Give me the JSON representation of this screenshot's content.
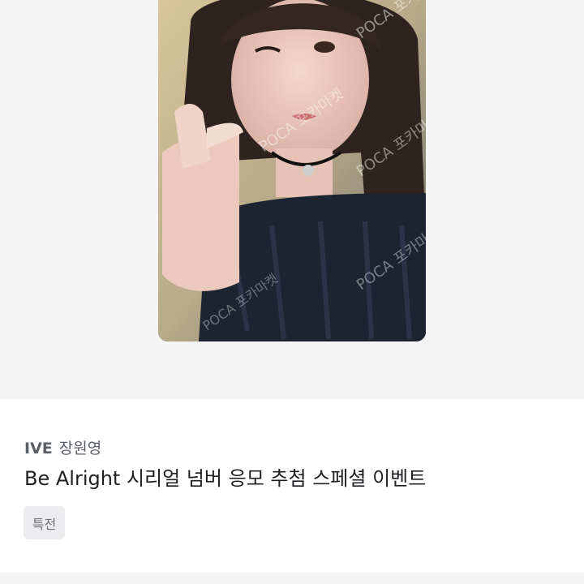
{
  "item": {
    "group": "IVE",
    "member": "장원영",
    "title": "Be Alright 시리얼 넘버 응모 추첨 스페셜 이벤트",
    "tag": "특전"
  },
  "photo": {
    "watermark": "POCA 포카마켓"
  },
  "colors": {
    "hero_background": "#f4f4f5",
    "tag_background": "#ececee",
    "title_text": "#1d1f22",
    "artist_text": "#5b5f66"
  }
}
